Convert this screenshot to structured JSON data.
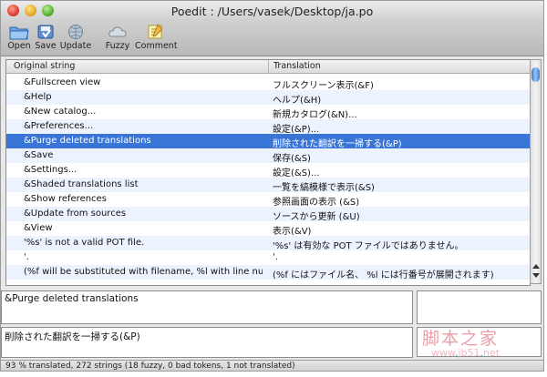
{
  "window": {
    "title": "Poedit : /Users/vasek/Desktop/ja.po"
  },
  "toolbar": {
    "open_label": "Open",
    "save_label": "Save",
    "update_label": "Update",
    "fuzzy_label": "Fuzzy",
    "comment_label": "Comment"
  },
  "list": {
    "header_original": "Original string",
    "header_translation": "Translation",
    "rows": [
      {
        "original": "&Fullscreen view",
        "translation": "フルスクリーン表示(&F)"
      },
      {
        "original": "&Help",
        "translation": "ヘルプ(&H)"
      },
      {
        "original": "&New catalog...",
        "translation": "新規カタログ(&N)..."
      },
      {
        "original": "&Preferences...",
        "translation": "設定(&P)..."
      },
      {
        "original": "&Purge deleted translations",
        "translation": "削除された翻訳を一掃する(&P)"
      },
      {
        "original": "&Save",
        "translation": "保存(&S)"
      },
      {
        "original": "&Settings...",
        "translation": "設定(&S)..."
      },
      {
        "original": "&Shaded translations list",
        "translation": "一覧を縞模様で表示(&S)"
      },
      {
        "original": "&Show references",
        "translation": "参照画面の表示 (&S)"
      },
      {
        "original": "&Update from sources",
        "translation": "ソースから更新 (&U)"
      },
      {
        "original": "&View",
        "translation": "表示(&V)"
      },
      {
        "original": "'%s' is not a valid POT file.",
        "translation": "'%s' は有効な POT ファイルではありません。"
      },
      {
        "original": "'.",
        "translation": "'."
      },
      {
        "original": "(%f will be substituted with filename, %l with line numb...",
        "translation": "(%f にはファイル名、 %l には行番号が展開されます)"
      }
    ],
    "selected_index": 4
  },
  "editor": {
    "source_text": "&Purge deleted translations",
    "translation_text": "削除された翻訳を一掃する(&P)"
  },
  "status": {
    "text": "93 % translated, 272 strings (18 fuzzy, 0 bad tokens, 1 not translated)"
  },
  "watermark": {
    "chars": "脚本之家",
    "url_prefix": "www",
    "url_dot1": ".",
    "url_mid": "jb51",
    "url_dot2": ".",
    "url_suffix": "net"
  },
  "colors": {
    "selection": "#3875d7",
    "alt_row": "#edf3fe"
  }
}
